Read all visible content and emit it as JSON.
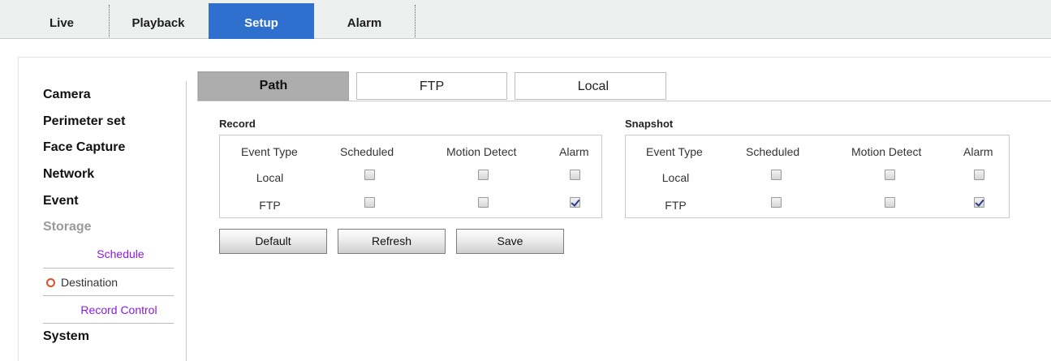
{
  "nav": {
    "tabs": [
      {
        "label": "Live"
      },
      {
        "label": "Playback"
      },
      {
        "label": "Setup",
        "active": true
      },
      {
        "label": "Alarm"
      }
    ],
    "active_color": "#2f6fcd"
  },
  "sidebar": {
    "camera": "Camera",
    "perimeter": "Perimeter set",
    "face": "Face Capture",
    "network": "Network",
    "event": "Event",
    "storage": "Storage",
    "storage_sub": {
      "schedule": "Schedule",
      "destination": "Destination",
      "record_control": "Record Control"
    },
    "system": "System"
  },
  "subtabs": [
    {
      "label": "Path",
      "active": true
    },
    {
      "label": "FTP"
    },
    {
      "label": "Local"
    }
  ],
  "record": {
    "title": "Record",
    "headers": [
      "Event Type",
      "Scheduled",
      "Motion Detect",
      "Alarm"
    ],
    "rows": [
      {
        "label": "Local",
        "scheduled": false,
        "motion": false,
        "alarm": false
      },
      {
        "label": "FTP",
        "scheduled": false,
        "motion": false,
        "alarm": true
      }
    ]
  },
  "snapshot": {
    "title": "Snapshot",
    "headers": [
      "Event Type",
      "Scheduled",
      "Motion Detect",
      "Alarm"
    ],
    "rows": [
      {
        "label": "Local",
        "scheduled": false,
        "motion": false,
        "alarm": false
      },
      {
        "label": "FTP",
        "scheduled": false,
        "motion": false,
        "alarm": true
      }
    ]
  },
  "buttons": {
    "default": "Default",
    "refresh": "Refresh",
    "save": "Save"
  },
  "colors": {
    "link": "#8a1ae0",
    "current_marker": "#e0502a"
  }
}
